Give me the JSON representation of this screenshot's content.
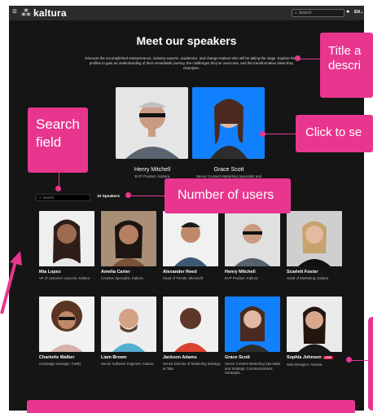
{
  "header": {
    "brand": "kaltura",
    "search_placeholder": "Search",
    "language": "EN"
  },
  "page": {
    "title": "Meet our speakers",
    "description": "Discover the accomplished entrepreneurs, industry experts, academics, and change-makers who will be taking the stage. Explore their profiles to gain an understanding of their remarkable journey, the challenges they've overcome, and the transformative ideas they champion."
  },
  "featured": [
    {
      "name": "Henry Mitchell",
      "role": "EVP Product, Kaltura"
    },
    {
      "name": "Grace Scott",
      "role": "Senior Content Marketing Specialist and"
    }
  ],
  "list": {
    "search_placeholder": "Search",
    "count_label": "10 Speakers"
  },
  "speakers": [
    {
      "name": "Mia Lopez",
      "role": "VP of customer success, Kaltura"
    },
    {
      "name": "Amelia Carter",
      "role": "Creative Specialist, Kaltura"
    },
    {
      "name": "Alexander Reed",
      "role": "Head of Trends, Microsoft"
    },
    {
      "name": "Henry Mitchell",
      "role": "EVP Product, Kaltura"
    },
    {
      "name": "Scarlett Foster",
      "role": "Head of Marketing, Kaltura"
    },
    {
      "name": "Charlotte Walker",
      "role": "Campaign manager, Fastly"
    },
    {
      "name": "Liam Brown",
      "role": "Senior Software Engineer, Kaltura"
    },
    {
      "name": "Jackson Adams",
      "role": "Senior Director of Marketing Strategy at Tata"
    },
    {
      "name": "Grace Scott",
      "role": "Senior Content Marketing Specialist and Strategic Communications Strategist..."
    },
    {
      "name": "Sophia Johnson",
      "role": "Web Designer, Akamai",
      "badge": "LIVE"
    }
  ],
  "annotations": {
    "title": "Title a\ndescri",
    "click": "Click to se",
    "search": "Search\nfield",
    "count": "Number of users"
  },
  "colors": {
    "accent": "#e8368f",
    "background": "#151515",
    "topbar": "#2b2b2b",
    "live": "#e11d48"
  }
}
